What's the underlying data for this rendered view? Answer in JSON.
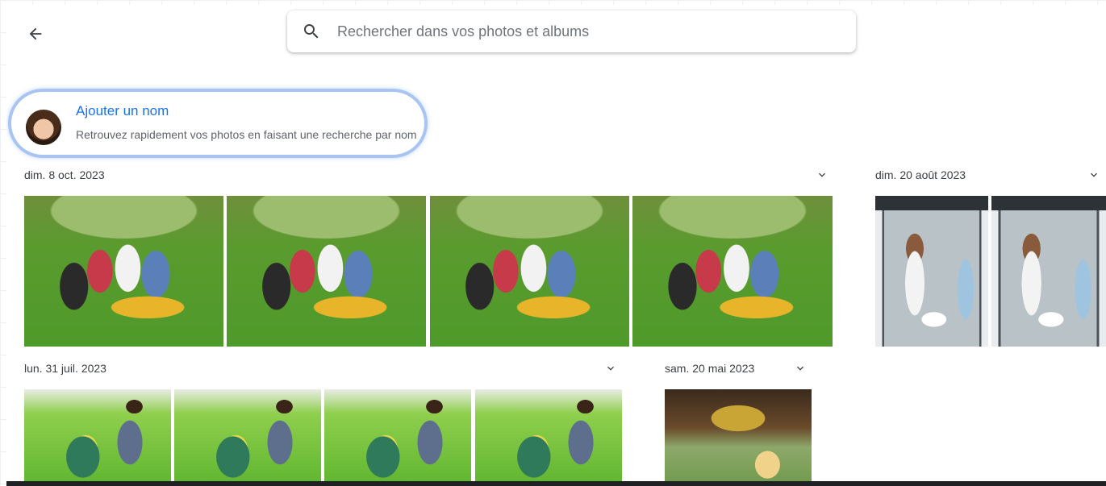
{
  "header": {
    "back_label": "",
    "search_placeholder": "Rechercher dans vos photos et albums"
  },
  "name_card": {
    "title": "Ajouter un nom",
    "description": "Retrouvez rapidement vos photos en faisant une recherche par nom"
  },
  "groups": [
    {
      "date": "dim. 8 oct. 2023",
      "photo_count": 4
    },
    {
      "date": "dim. 20 août 2023",
      "photo_count": 2
    },
    {
      "date": "lun. 31 juil. 2023",
      "photo_count": 4
    },
    {
      "date": "sam. 20 mai 2023",
      "photo_count": 1
    }
  ],
  "icons": {
    "back": "arrow-left-icon",
    "search": "search-icon",
    "expand": "chevron-down-icon"
  },
  "colors": {
    "accent": "#1a73e8",
    "highlight_ring": "#a8c4f2"
  }
}
